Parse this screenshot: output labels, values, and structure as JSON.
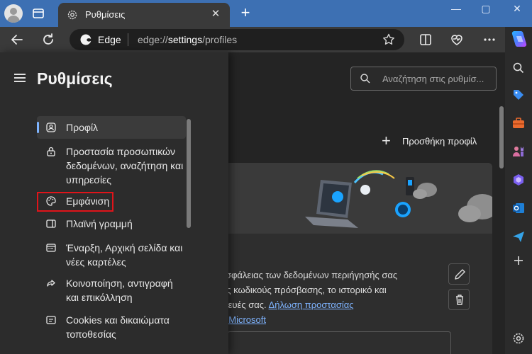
{
  "browser": {
    "tab_title": "Ρυθμίσεις",
    "tab_close": "✕",
    "new_tab": "+",
    "window_controls": [
      "—",
      "▢",
      "✕"
    ],
    "site_name": "Edge",
    "url_prefix": "edge://",
    "url_highlight": "settings",
    "url_suffix": "/profiles"
  },
  "settings": {
    "title": "Ρυθμίσεις",
    "search_placeholder": "Αναζήτηση στις ρυθμίσ...",
    "add_profile": "Προσθήκη προφίλ",
    "nav": [
      {
        "label": "Προφίλ",
        "icon": "profile-icon"
      },
      {
        "label": "Προστασία προσωπικών δεδομένων, αναζήτηση και υπηρεσίες",
        "icon": "lock-icon"
      },
      {
        "label": "Εμφάνιση",
        "icon": "palette-icon"
      },
      {
        "label": "Πλαϊνή γραμμή",
        "icon": "sidebar-icon"
      },
      {
        "label": "Έναρξη, Αρχική σελίδα και νέες καρτέλες",
        "icon": "home-tabs-icon"
      },
      {
        "label": "Κοινοποίηση, αντιγραφή και επικόλληση",
        "icon": "share-icon"
      },
      {
        "label": "Cookies και δικαιώματα τοποθεσίας",
        "icon": "cookie-icon"
      }
    ],
    "card_text_line1": "χ ασφάλειας των δεδομένων περιήγησής σας",
    "card_text_line2": "τους κωδικούς πρόσβασης, το ιστορικό και",
    "card_text_line3": "υσκευές σας.",
    "card_link_line3": "Δήλωση προστασίας",
    "card_link_line4": "της Microsoft"
  },
  "colors": {
    "accent": "#7eb4ff",
    "highlight": "#e0141a",
    "titlebar": "#3d70b3"
  }
}
